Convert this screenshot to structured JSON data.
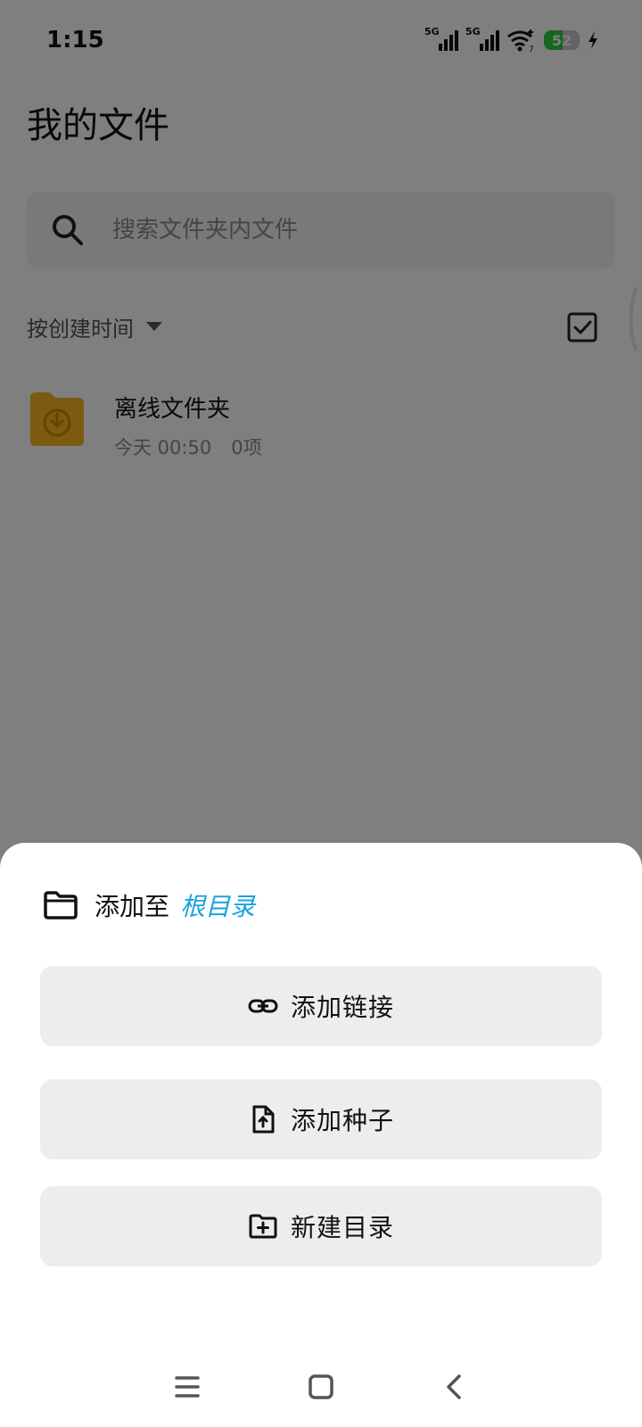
{
  "status_bar": {
    "time": "1:15",
    "signal1_label": "5G",
    "signal2_label": "5G",
    "wifi_badge": "7",
    "battery_level": "52",
    "battery_fraction": 0.52,
    "battery_color": "#2ecc40"
  },
  "page": {
    "title": "我的文件"
  },
  "search": {
    "placeholder": "搜索文件夹内文件",
    "value": ""
  },
  "sort": {
    "label": "按创建时间"
  },
  "files": [
    {
      "name": "离线文件夹",
      "date": "今天 00:50",
      "count": "0项",
      "icon": "offline-folder-icon",
      "color": "#f5b623"
    }
  ],
  "sheet": {
    "prefix": "添加至",
    "target": "根目录",
    "target_color": "#1aa2e0",
    "actions": [
      {
        "label": "添加链接",
        "icon": "link-icon"
      },
      {
        "label": "添加种子",
        "icon": "file-upload-icon"
      },
      {
        "label": "新建目录",
        "icon": "folder-add-icon"
      }
    ]
  },
  "nav": {
    "menu_icon": "menu-icon",
    "home_icon": "home-icon",
    "back_icon": "back-icon"
  }
}
